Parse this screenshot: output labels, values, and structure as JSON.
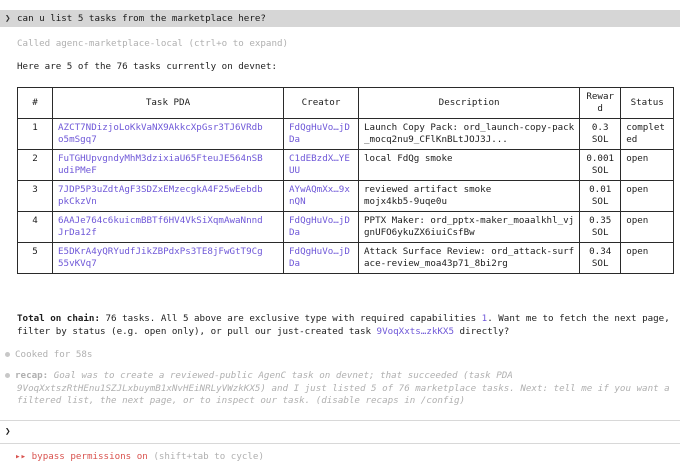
{
  "prompt": {
    "chevron": "❯",
    "text": "can u list 5 tasks from the marketplace here?"
  },
  "tool_call": "Called agenc-marketplace-local (ctrl+o to expand)",
  "intro": "Here are 5 of the 76 tasks currently on devnet:",
  "table": {
    "headers": [
      "#",
      "Task PDA",
      "Creator",
      "Description",
      "Rewar\nd",
      "Status"
    ],
    "rows": [
      {
        "num": "1",
        "pda": "AZCT7NDizjoLoKkVaNX9AkkcXpGsr3TJ6VRdb\no5mSgq7",
        "creator": "FdQgHuVo…jD\nDa",
        "desc": "Launch Copy Pack: ord_launch-copy-pack\n_mocq2nu9_CFlKnBLtJOJ3J...",
        "reward": "0.3\nSOL",
        "status": "complet\ned"
      },
      {
        "num": "2",
        "pda": "FuTGHUpvgndyMhM3dzixiaU65FteuJE564nSB\nudiPMeF",
        "creator": "C1dEBzdX…YE\nUU",
        "desc": "local FdQg smoke",
        "reward": "0.001\nSOL",
        "status": "open"
      },
      {
        "num": "3",
        "pda": "7JDP5P3uZdtAgF3SDZxEMzecgkA4F25wEebdb\npkCkzVn",
        "creator": "AYwAQmXx…9x\nnQN",
        "desc": "reviewed artifact smoke\nmojx4kb5-9uqe0u",
        "reward": "0.01\nSOL",
        "status": "open"
      },
      {
        "num": "4",
        "pda": "6AAJe764c6kuicmBBTf6HV4VkSiXqmAwaNnnd\nJrDa12f",
        "creator": "FdQgHuVo…jD\nDa",
        "desc": "PPTX Maker: ord_pptx-maker_moaalkhl_vj\ngnUFO6ykuZX6iuiCsfBw",
        "reward": "0.35\nSOL",
        "status": "open"
      },
      {
        "num": "5",
        "pda": "E5DKrA4yQRYudfJikZBPdxPs3TE8jFwGtT9Cg\n55vKVq7",
        "creator": "FdQgHuVo…jD\nDa",
        "desc": "Attack Surface Review: ord_attack-surf\nace-review_moa43p71_8bi2rg",
        "reward": "0.34\nSOL",
        "status": "open"
      }
    ]
  },
  "summary": {
    "label": "Total on chain:",
    "text1": " 76 tasks. All 5 above are exclusive type with required capabilities ",
    "cap": "1",
    "text2": ". Want me to fetch the next page,",
    "line2a": "filter by status (e.g. open only), or pull our just-created task ",
    "task_link": "9VoqXxts…zkKX5",
    "line2b": " directly?"
  },
  "cooked": "Cooked for 58s",
  "recap": {
    "label": "recap:",
    "line1": " Goal was to create a reviewed-public AgenC task on devnet; that succeeded (task PDA",
    "line2": "9VoqXxtszRtHEnu1SZJLxbuymB1xNvHEiNRLyVWzkKX5) and I just listed 5 of 76 marketplace tasks. Next: tell me if you want a",
    "line3": "filtered list, the next page, or to inspect our task. (disable recaps in /config)"
  },
  "input": {
    "prompt_char": "❯"
  },
  "footer": {
    "arrows": "▸▸",
    "mode": "bypass permissions on",
    "hint": "(shift+tab to cycle)"
  },
  "colors": {
    "accent_purple": "#6f58d8",
    "mode_red": "#d9534f",
    "prompt_bg": "#d6d6d6"
  }
}
